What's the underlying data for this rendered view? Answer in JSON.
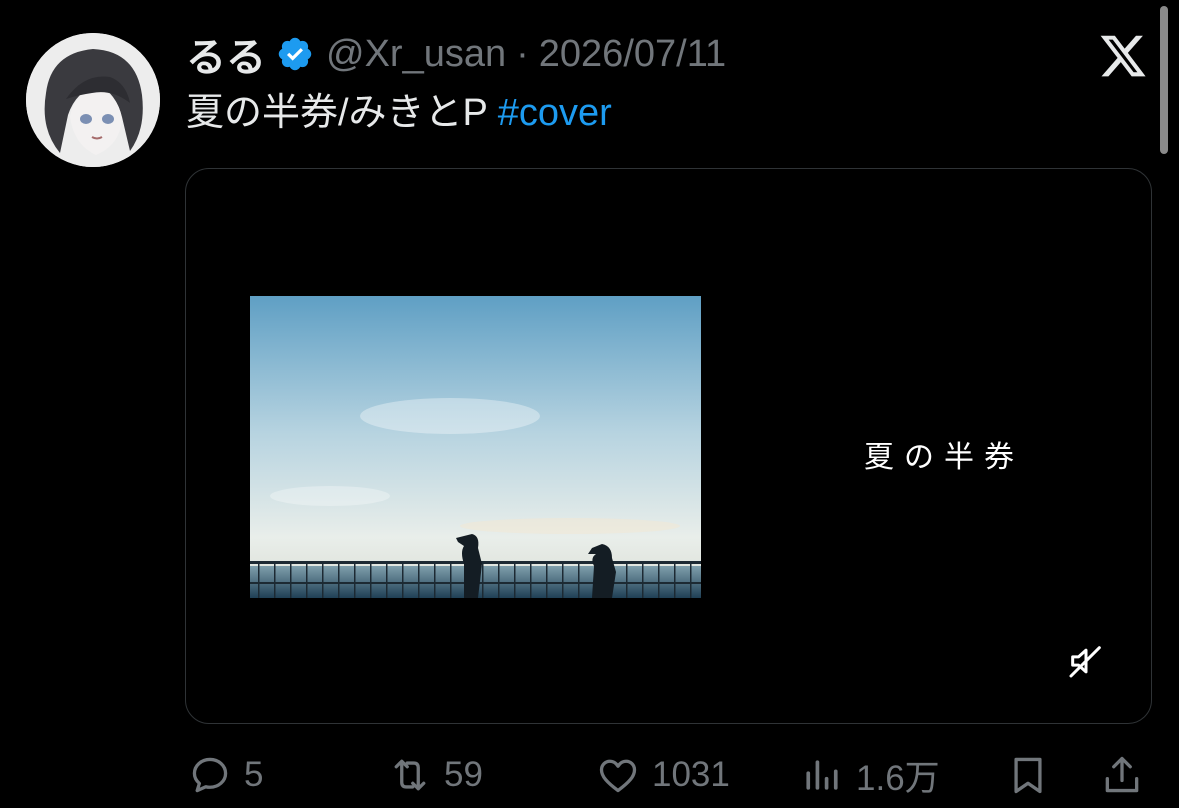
{
  "post": {
    "display_name": "るる",
    "handle": "@Xr_usan",
    "separator": "·",
    "date": "2026/07/11",
    "text_plain": "夏の半券/みきとP ",
    "hashtag": "#cover",
    "media": {
      "overlay_title": "夏の半券",
      "mute_icon": "mute-icon"
    }
  },
  "actions": {
    "replies": "5",
    "reposts": "59",
    "likes": "1031",
    "views": "1.6万"
  },
  "icons": {
    "verified": "verified-badge-icon",
    "brand": "x-logo-icon",
    "reply": "reply-icon",
    "repost": "repost-icon",
    "like": "heart-icon",
    "views": "views-icon",
    "bookmark": "bookmark-icon",
    "share": "share-icon"
  },
  "colors": {
    "background": "#000000",
    "text": "#e7e9ea",
    "muted": "#71767b",
    "accent": "#1d9bf0"
  }
}
